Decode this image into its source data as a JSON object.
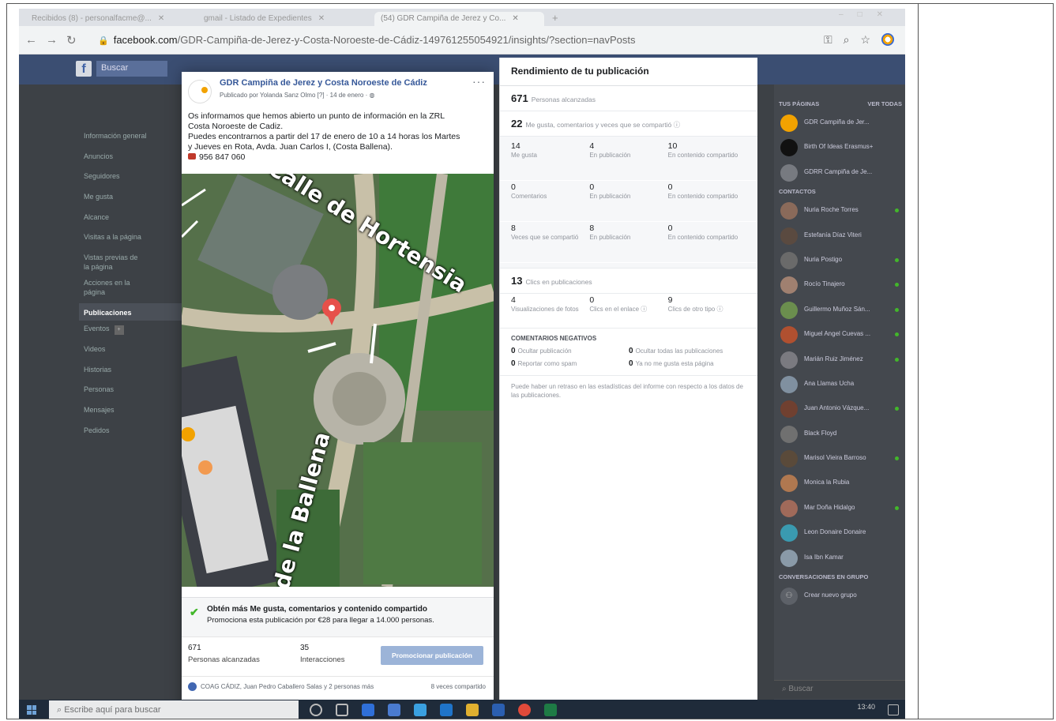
{
  "browser": {
    "tabs": [
      {
        "label": "Recibidos (8) - personalfacme@...",
        "active": false
      },
      {
        "label": "gmail - Listado de Expedientes",
        "active": false
      },
      {
        "label": "(54) GDR Campiña de Jerez y Co...",
        "active": true
      }
    ],
    "url_host": "facebook.com",
    "url_path": "/GDR-Campiña-de-Jerez-y-Costa-Noroeste-de-Cádiz-149761255054921/insights/?section=navPosts"
  },
  "fb": {
    "search_label": "Buscar"
  },
  "leftnav": {
    "items": [
      {
        "label": "Información general"
      },
      {
        "label": "Anuncios"
      },
      {
        "label": "Seguidores"
      },
      {
        "label": "Me gusta"
      },
      {
        "label": "Alcance"
      },
      {
        "label": "Visitas a la página"
      },
      {
        "label": "Vistas previas de la página"
      },
      {
        "label": "Acciones en la página"
      },
      {
        "label": "Publicaciones",
        "active": true
      },
      {
        "label": "Eventos"
      },
      {
        "label": "Videos"
      },
      {
        "label": "Historias"
      },
      {
        "label": "Personas"
      },
      {
        "label": "Mensajes"
      },
      {
        "label": "Pedidos"
      }
    ]
  },
  "post": {
    "page_name": "GDR Campiña de Jerez y Costa Noroeste de Cádiz",
    "meta": "Publicado por Yolanda Sanz Olmo [?] · 14 de enero · ",
    "text_lines": [
      "Os informamos que hemos abierto un punto de información en la ZRL",
      "Costa Noroeste de Cadiz.",
      "Puedes encontrarnos a partir del 17 de enero de 10 a 14 horas los Martes",
      "y Jueves en Rota, Avda. Juan Carlos I, (Costa Ballena)."
    ],
    "phone": "956 847 060",
    "map_labels": {
      "street1": "Calle de Hortensia",
      "street2": "de la Ballena"
    },
    "promo_title": "Obtén más Me gusta, comentarios y contenido compartido",
    "promo_text": "Promociona esta publicación por €28 para llegar a 14.000 personas.",
    "reach_value": "671",
    "reach_label": "Personas alcanzadas",
    "interactions_value": "35",
    "interactions_label": "Interacciones",
    "promote_button": "Promocionar publicación",
    "shared_by": "COAG CÁDIZ, Juan Pedro Caballero Salas y 2 personas más",
    "shared_count": "8 veces compartido"
  },
  "insights": {
    "title": "Rendimiento de tu publicación",
    "reach_value": "671",
    "reach_label": "Personas alcanzadas",
    "reactions_value": "22",
    "reactions_label": "Me gusta, comentarios y veces que se compartió",
    "reaction_grid": [
      [
        {
          "n": "14",
          "l": "Me gusta"
        },
        {
          "n": "4",
          "l": "En publicación"
        },
        {
          "n": "10",
          "l": "En contenido compartido"
        }
      ],
      [
        {
          "n": "0",
          "l": "Comentarios"
        },
        {
          "n": "0",
          "l": "En publicación"
        },
        {
          "n": "0",
          "l": "En contenido compartido"
        }
      ],
      [
        {
          "n": "8",
          "l": "Veces que se compartió"
        },
        {
          "n": "8",
          "l": "En publicación"
        },
        {
          "n": "0",
          "l": "En contenido compartido"
        }
      ]
    ],
    "clicks_value": "13",
    "clicks_label": "Clics en publicaciones",
    "clicks_grid": [
      {
        "n": "4",
        "l": "Visualizaciones de fotos"
      },
      {
        "n": "0",
        "l": "Clics en el enlace"
      },
      {
        "n": "9",
        "l": "Clics de otro tipo"
      }
    ],
    "negative_title": "COMENTARIOS NEGATIVOS",
    "negative": [
      {
        "n": "0",
        "l": "Ocultar publicación"
      },
      {
        "n": "0",
        "l": "Ocultar todas las publicaciones"
      },
      {
        "n": "0",
        "l": "Reportar como spam"
      },
      {
        "n": "0",
        "l": "Ya no me gusta esta página"
      }
    ],
    "note": "Puede haber un retraso en las estadísticas del informe con respecto a los datos de las publicaciones."
  },
  "sidebar": {
    "pages_title": "TUS PÁGINAS",
    "see_all": "VER TODAS",
    "pages": [
      {
        "name": "GDR Campiña de Jer...",
        "color": "#f2a200"
      },
      {
        "name": "Birth Of Ideas Erasmus+",
        "color": "#111111"
      },
      {
        "name": "GDRR Campiña de Je...",
        "color": "#777a80"
      }
    ],
    "contacts_title": "CONTACTOS",
    "contacts": [
      {
        "name": "Nuria Roche Torres",
        "color": "#8a6a5a",
        "online": true
      },
      {
        "name": "Estefanía Díaz Viteri",
        "color": "#5a4a40",
        "online": false
      },
      {
        "name": "Nuria Postigo",
        "color": "#6a6a6a",
        "online": true
      },
      {
        "name": "Rocío Tinajero",
        "color": "#a08070",
        "online": true
      },
      {
        "name": "Guillermo Muñoz Sán...",
        "color": "#6b8e4e",
        "online": true
      },
      {
        "name": "Miguel Angel Cuevas ...",
        "color": "#b05030",
        "online": true
      },
      {
        "name": "Marián Ruiz Jiménez",
        "color": "#7a7a80",
        "online": true
      },
      {
        "name": "Ana Llamas Ucha",
        "color": "#8090a0",
        "online": false
      },
      {
        "name": "Juan Antonio Vázque...",
        "color": "#704030",
        "online": true
      },
      {
        "name": "Black Floyd",
        "color": "#707070",
        "online": false
      },
      {
        "name": "Marisol Vieira Barroso",
        "color": "#5a4a3a",
        "online": true
      },
      {
        "name": "Monica la Rubia",
        "color": "#b07850",
        "online": false
      },
      {
        "name": "Mar Doña Hidalgo",
        "color": "#a06a5a",
        "online": true
      },
      {
        "name": "Leon Donaire Donaire",
        "color": "#3a9ab0",
        "online": false
      },
      {
        "name": "Isa Ibn Kamar",
        "color": "#8a9aa8",
        "online": false
      }
    ],
    "groups_title": "CONVERSACIONES EN GRUPO",
    "new_group": "Crear nuevo grupo",
    "search_placeholder": "Buscar"
  },
  "taskbar": {
    "search_placeholder": "Escribe aquí para buscar",
    "time": "13:40"
  }
}
